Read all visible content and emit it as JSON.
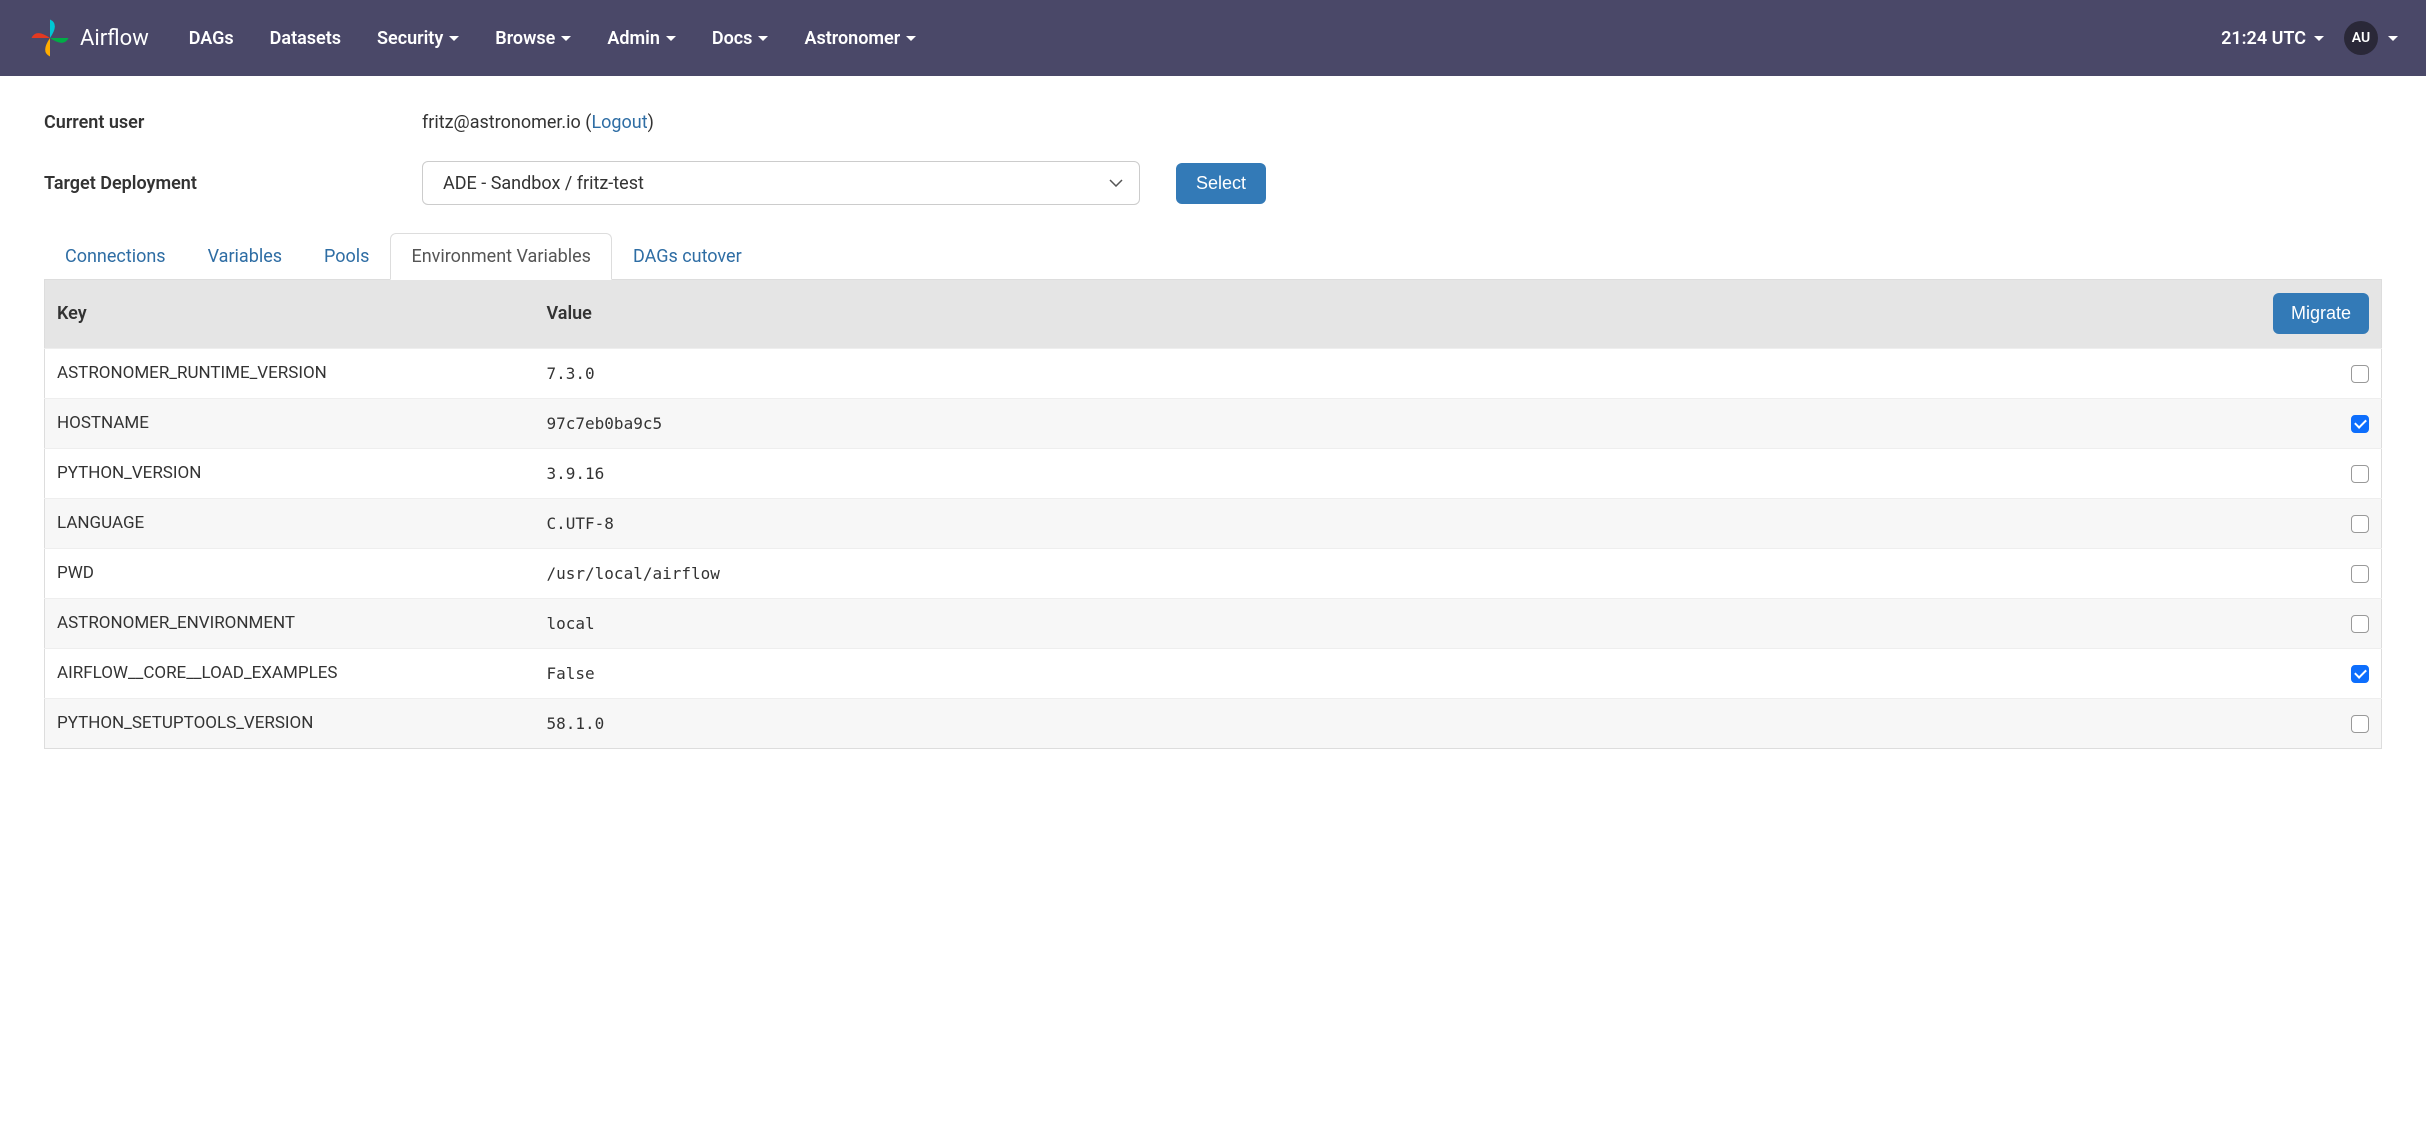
{
  "navbar": {
    "brand": "Airflow",
    "items": [
      {
        "label": "DAGs",
        "dropdown": false
      },
      {
        "label": "Datasets",
        "dropdown": false
      },
      {
        "label": "Security",
        "dropdown": true
      },
      {
        "label": "Browse",
        "dropdown": true
      },
      {
        "label": "Admin",
        "dropdown": true
      },
      {
        "label": "Docs",
        "dropdown": true
      },
      {
        "label": "Astronomer",
        "dropdown": true
      }
    ],
    "time": "21:24 UTC",
    "avatar": "AU"
  },
  "form": {
    "current_user_label": "Current user",
    "current_user_value": "fritz@astronomer.io",
    "logout_label": "Logout",
    "target_deployment_label": "Target Deployment",
    "target_deployment_value": "ADE - Sandbox / fritz-test",
    "select_button": "Select"
  },
  "tabs": [
    {
      "label": "Connections",
      "active": false
    },
    {
      "label": "Variables",
      "active": false
    },
    {
      "label": "Pools",
      "active": false
    },
    {
      "label": "Environment Variables",
      "active": true
    },
    {
      "label": "DAGs cutover",
      "active": false
    }
  ],
  "table": {
    "headers": {
      "key": "Key",
      "value": "Value",
      "migrate": "Migrate"
    },
    "rows": [
      {
        "key": "ASTRONOMER_RUNTIME_VERSION",
        "value": "7.3.0",
        "checked": false
      },
      {
        "key": "HOSTNAME",
        "value": "97c7eb0ba9c5",
        "checked": true
      },
      {
        "key": "PYTHON_VERSION",
        "value": "3.9.16",
        "checked": false
      },
      {
        "key": "LANGUAGE",
        "value": "C.UTF-8",
        "checked": false
      },
      {
        "key": "PWD",
        "value": "/usr/local/airflow",
        "checked": false
      },
      {
        "key": "ASTRONOMER_ENVIRONMENT",
        "value": "local",
        "checked": false
      },
      {
        "key": "AIRFLOW__CORE__LOAD_EXAMPLES",
        "value": "False",
        "checked": true
      },
      {
        "key": "PYTHON_SETUPTOOLS_VERSION",
        "value": "58.1.0",
        "checked": false
      }
    ]
  }
}
